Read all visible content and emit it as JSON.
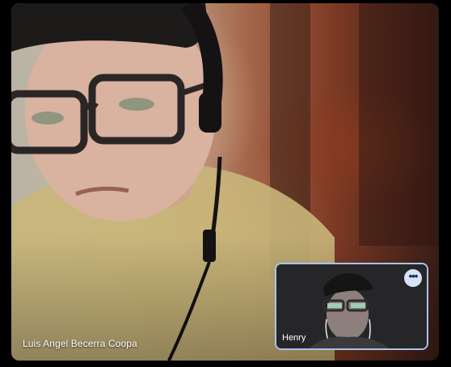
{
  "call": {
    "main_participant": {
      "name": "Luis Angel Becerra Coopa"
    },
    "self_view": {
      "name": "Henry",
      "more_options_icon": "more-horiz-icon"
    }
  },
  "colors": {
    "self_view_border": "#a9c2ec",
    "more_button_bg": "#d6e3f8"
  }
}
